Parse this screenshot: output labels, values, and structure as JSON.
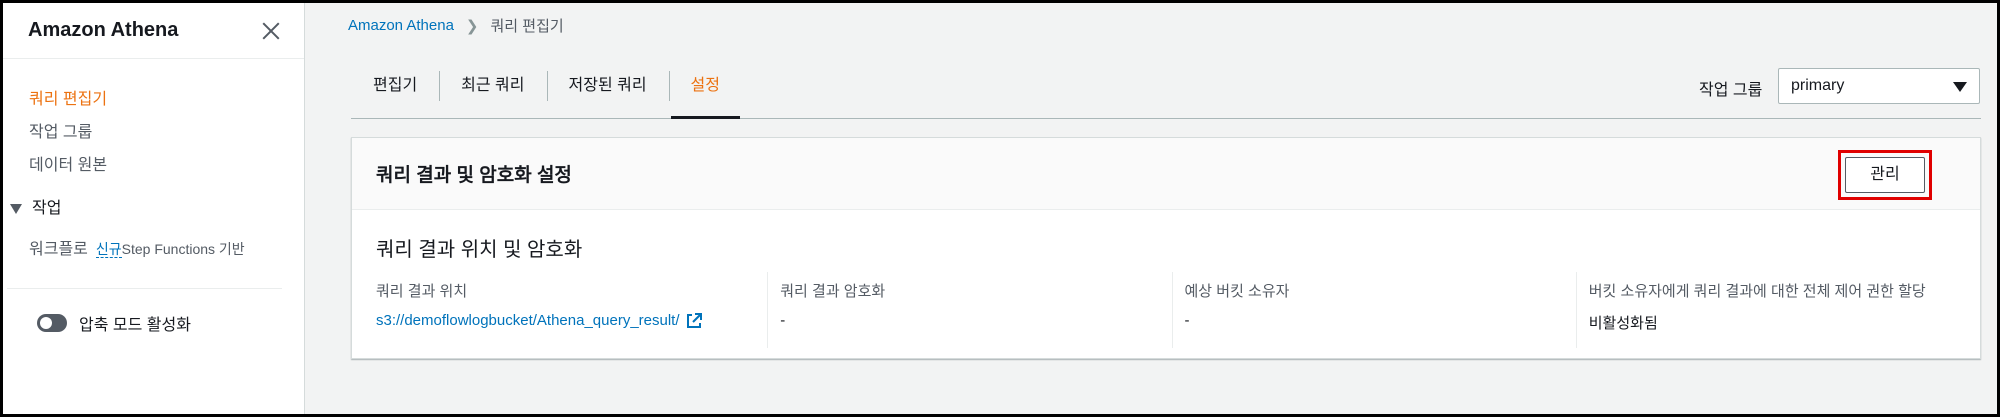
{
  "sidebar": {
    "title": "Amazon Athena",
    "items": [
      {
        "label": "쿼리 편집기"
      },
      {
        "label": "작업 그룹"
      },
      {
        "label": "데이터 원본"
      }
    ],
    "section": "작업",
    "workflow": {
      "label": "워크플로",
      "badge": "신규",
      "sub": "Step Functions 기반"
    },
    "toggle_label": "압축 모드 활성화"
  },
  "breadcrumb": {
    "root": "Amazon Athena",
    "current": "쿼리 편집기"
  },
  "tabs": [
    {
      "label": "편집기"
    },
    {
      "label": "최근 쿼리"
    },
    {
      "label": "저장된 쿼리"
    },
    {
      "label": "설정"
    }
  ],
  "workgroup": {
    "label": "작업 그룹",
    "value": "primary"
  },
  "card": {
    "title": "쿼리 결과 및 암호화 설정",
    "manage_label": "관리",
    "section_title": "쿼리 결과 위치 및 암호화",
    "columns": [
      {
        "label": "쿼리 결과 위치",
        "value": "s3://demoflowlogbucket/Athena_query_result/"
      },
      {
        "label": "쿼리 결과 암호화",
        "value": "-"
      },
      {
        "label": "예상 버킷 소유자",
        "value": "-"
      },
      {
        "label": "버킷 소유자에게 쿼리 결과에 대한 전체 제어 권한 할당",
        "value": "비활성화됨"
      }
    ]
  },
  "colors": {
    "accent": "#ec7211",
    "link": "#0073bb",
    "highlight": "#e00000"
  }
}
